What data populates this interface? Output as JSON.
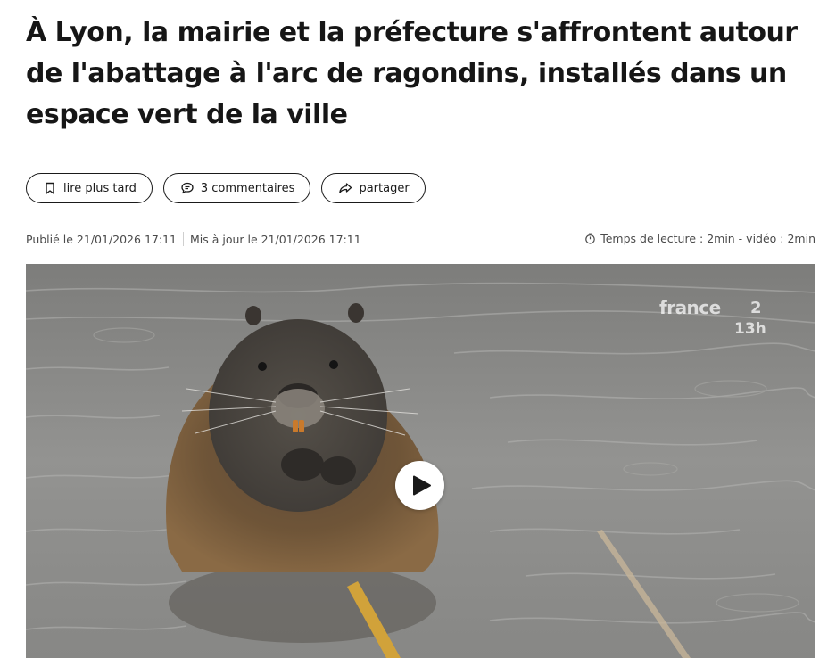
{
  "article": {
    "title": "À Lyon, la mairie et la préfecture s'affrontent autour de l'abattage à l'arc de ragondins, installés dans un espace vert de la ville"
  },
  "actions": {
    "read_later": "lire plus tard",
    "comments": "3 commentaires",
    "share": "partager"
  },
  "meta": {
    "published": "Publié le 21/01/2026 17:11",
    "updated": "Mis à jour le 21/01/2026 17:11",
    "reading_time": "Temps de lecture : 2min - vidéo : 2min"
  },
  "video": {
    "channel_logo_text": "france",
    "channel_number": "2",
    "channel_edition": "13h"
  },
  "icons": {
    "read_later": "bookmark-icon",
    "comments": "speech-bubble-icon",
    "share": "share-arrow-icon",
    "reading_time": "stopwatch-icon",
    "play": "play-icon"
  },
  "colors": {
    "text": "#161616",
    "meta_text": "#4a4a4a",
    "water": "#8f8f8d",
    "button_border": "#1a1a1a"
  }
}
